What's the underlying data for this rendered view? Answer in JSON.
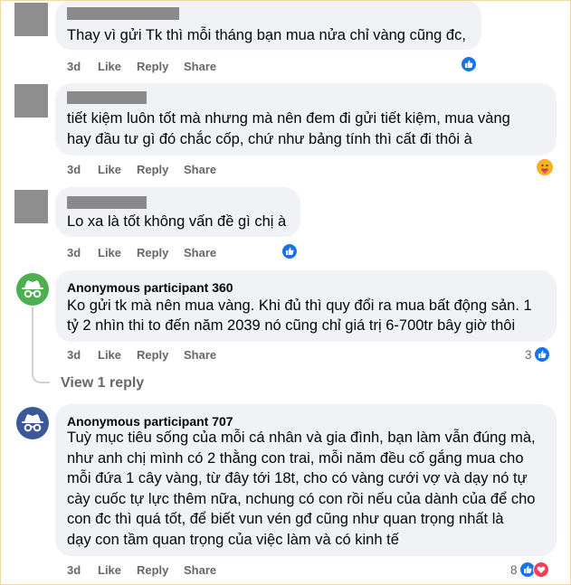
{
  "comments": [
    {
      "author": "",
      "avatar": "gray-square",
      "lines": [
        "Thay vì gửi Tk thì mỗi tháng bạn mua nửa chỉ vàng cũng đc,"
      ],
      "time": "3d",
      "like": "Like",
      "reply": "Reply",
      "share": "Share",
      "reaction_icons": [
        "like-icon"
      ],
      "reaction_count": ""
    },
    {
      "author": "",
      "avatar": "gray-square",
      "lines": [
        "tiết kiệm luôn tốt mà nhưng mà nên đem đi gửi tiết kiệm, mua vàng",
        "hay đầu tư gì đó chắc cốp, chứ như bảng tính thì cất đi thôi à"
      ],
      "time": "3d",
      "like": "Like",
      "reply": "Reply",
      "share": "Share",
      "reaction_icons": [
        "care-icon"
      ],
      "reaction_count": ""
    },
    {
      "author": "",
      "avatar": "gray-square",
      "lines": [
        "Lo xa là tốt không vấn đề gì chị à"
      ],
      "time": "3d",
      "like": "Like",
      "reply": "Reply",
      "share": "Share",
      "reaction_icons": [
        "like-icon"
      ],
      "reaction_count": ""
    },
    {
      "author": "Anonymous participant 360",
      "avatar": "anonymous-green",
      "lines": [
        "Ko gửi tk mà nên mua vàng. Khi đủ thì quy đổi ra mua bất động sản. 1",
        "tỷ 2 nhìn thi to đến năm 2039 nó cũng chỉ giá trị 6-700tr bây giờ thôi"
      ],
      "time": "3d",
      "like": "Like",
      "reply": "Reply",
      "share": "Share",
      "reaction_icons": [
        "like-icon"
      ],
      "reaction_count": "3",
      "view_replies": "View 1 reply"
    },
    {
      "author": "Anonymous participant 707",
      "avatar": "anonymous-blue",
      "lines": [
        "Tuỳ mục tiêu sống của mỗi cá nhân và gia đình, bạn làm vẫn đúng mà,",
        "như anh chị mình có 2 thằng con trai, mỗi năm đều cố gắng mua cho",
        "mỗi đứa 1 cây vàng, từ đây tới 18t, cho có vàng cưới vợ và dạy nó tự",
        "cày cuốc tự lực thêm nữa, nchung có con rồi nếu của dành của để cho",
        "con đc thì quá tốt, để biết vun vén gđ cũng như quan trọng nhất là",
        "dạy con tầm quan trọng của việc làm và có kinh tế"
      ],
      "time": "3d",
      "like": "Like",
      "reply": "Reply",
      "share": "Share",
      "reaction_icons": [
        "like-icon",
        "love-icon"
      ],
      "reaction_count": "8"
    }
  ],
  "colors": {
    "bubble": "#f0f2f5",
    "meta_text": "#65676b",
    "like_blue": "#1b74e4",
    "love_red": "#f33e58",
    "anon_green": "#4caf50",
    "anon_blue": "#3b5998"
  }
}
